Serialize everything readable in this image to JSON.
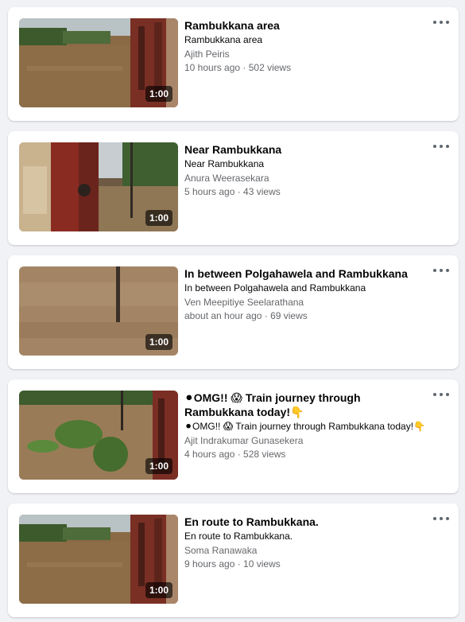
{
  "videos": [
    {
      "title": "Rambukkana area",
      "subtitle": "Rambukkana area",
      "author": "Ajith Peiris",
      "meta": "10 hours ago · 502 views",
      "duration": "1:00"
    },
    {
      "title": "Near Rambukkana",
      "subtitle": "Near Rambukkana",
      "author": "Anura Weerasekara",
      "meta": "5 hours ago · 43 views",
      "duration": "1:00"
    },
    {
      "title": "In between Polgahawela and Rambukkana",
      "subtitle": "In between Polgahawela and Rambukkana",
      "author": "Ven Meepitiye Seelarathana",
      "meta": "about an hour ago · 69 views",
      "duration": "1:00"
    },
    {
      "title": "⚫OMG!! 😱 Train journey through Rambukkana today!👇",
      "subtitle": "⚫OMG!! 😱 Train journey through Rambukkana today!👇",
      "author": "Ajit Indrakumar Gunasekera",
      "meta": "4 hours ago · 528 views",
      "duration": "1:00"
    },
    {
      "title": "En route to Rambukkana.",
      "subtitle": "En route to Rambukkana.",
      "author": "Soma Ranawaka",
      "meta": "9 hours ago · 10 views",
      "duration": "1:00"
    }
  ]
}
